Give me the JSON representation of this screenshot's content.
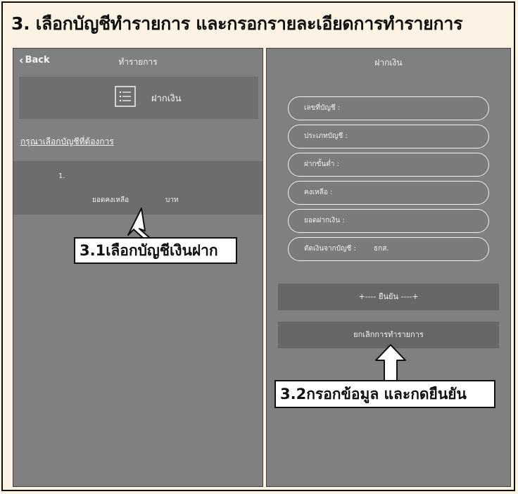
{
  "heading": "3. เลือกบัญชีทำรายการ และกรอกรายละเอียดการทำรายการ",
  "left_screen": {
    "back_label": "Back",
    "nav_title": "ทำรายการ",
    "menu_label": "ฝากเงิน",
    "menu_icon": "list-icon",
    "choose_account_text": "กรุณาเลือกบัญชีที่ต้องการ",
    "account": {
      "number": "1.",
      "balance_label": "ยอดคงเหลือ",
      "unit": "บาท"
    }
  },
  "right_screen": {
    "nav_title": "ฝากเงิน",
    "fields": [
      {
        "label": "เลขที่บัญชี :"
      },
      {
        "label": "ประเภทบัญชี :"
      },
      {
        "label": "ฝากขั้นต่ำ :"
      },
      {
        "label": "คงเหลือ :"
      },
      {
        "label": "ยอดฝากเงิน :"
      },
      {
        "label": "ตัดเงินจากบัญชี :",
        "value": "ธกส."
      }
    ],
    "confirm_label": "+---- ยืนยัน ----+",
    "cancel_label": "ยกเลิกการทำรายการ"
  },
  "callouts": {
    "step1": "3.1เลือกบัญชีเงินฝาก",
    "step2": "3.2กรอกข้อมูล และกดยืนยัน"
  },
  "colors": {
    "background": "#fdf3e4",
    "screen": "#808080",
    "panel": "#6d6d6d"
  }
}
